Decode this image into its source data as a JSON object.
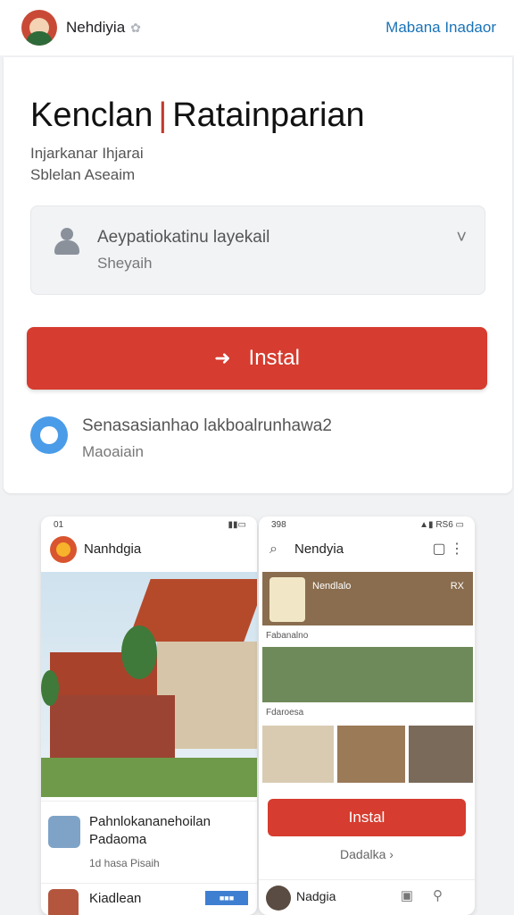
{
  "header": {
    "app_name": "Nehdiyia",
    "verified_icon": "verified-badge-icon",
    "right_link": "Mabana Inadaor"
  },
  "main": {
    "title_left": "Kenclan",
    "title_separator": "|",
    "title_right": "Ratainparian",
    "subtitle_line1": "Injarkanar Ihjarai",
    "subtitle_line2": "Sblelan Aseaim",
    "account": {
      "name": "Aeypatiokatinu layekail",
      "sub": "Sheyaih",
      "chevron": "˅"
    },
    "install_button": "Instal",
    "info": {
      "text": "Senasasianhao lakboalrunhawa2",
      "sub": "Maoaiain"
    }
  },
  "screenshot1": {
    "status_left": "01",
    "title": "Nanhdgia",
    "app_name_line1": "Pahnlokananehoilan",
    "app_name_line2": "Padaoma",
    "app_meta": "1d hasa Pisaih",
    "bottom_name": "Kiadlean"
  },
  "screenshot2": {
    "status_left": "398",
    "status_right": "RS6",
    "title": "Nendyia",
    "tile_label": "Nendlalo",
    "tile_badge": "RX",
    "caption1": "Fabanalno",
    "caption2": "Fdaroesa",
    "install_button": "Instal",
    "details_link": "Dadalka",
    "bottom_name": "Nadgia"
  },
  "colors": {
    "accent_red": "#d63c2f",
    "link_blue": "#1a73b8",
    "info_blue": "#4a9ce8"
  }
}
